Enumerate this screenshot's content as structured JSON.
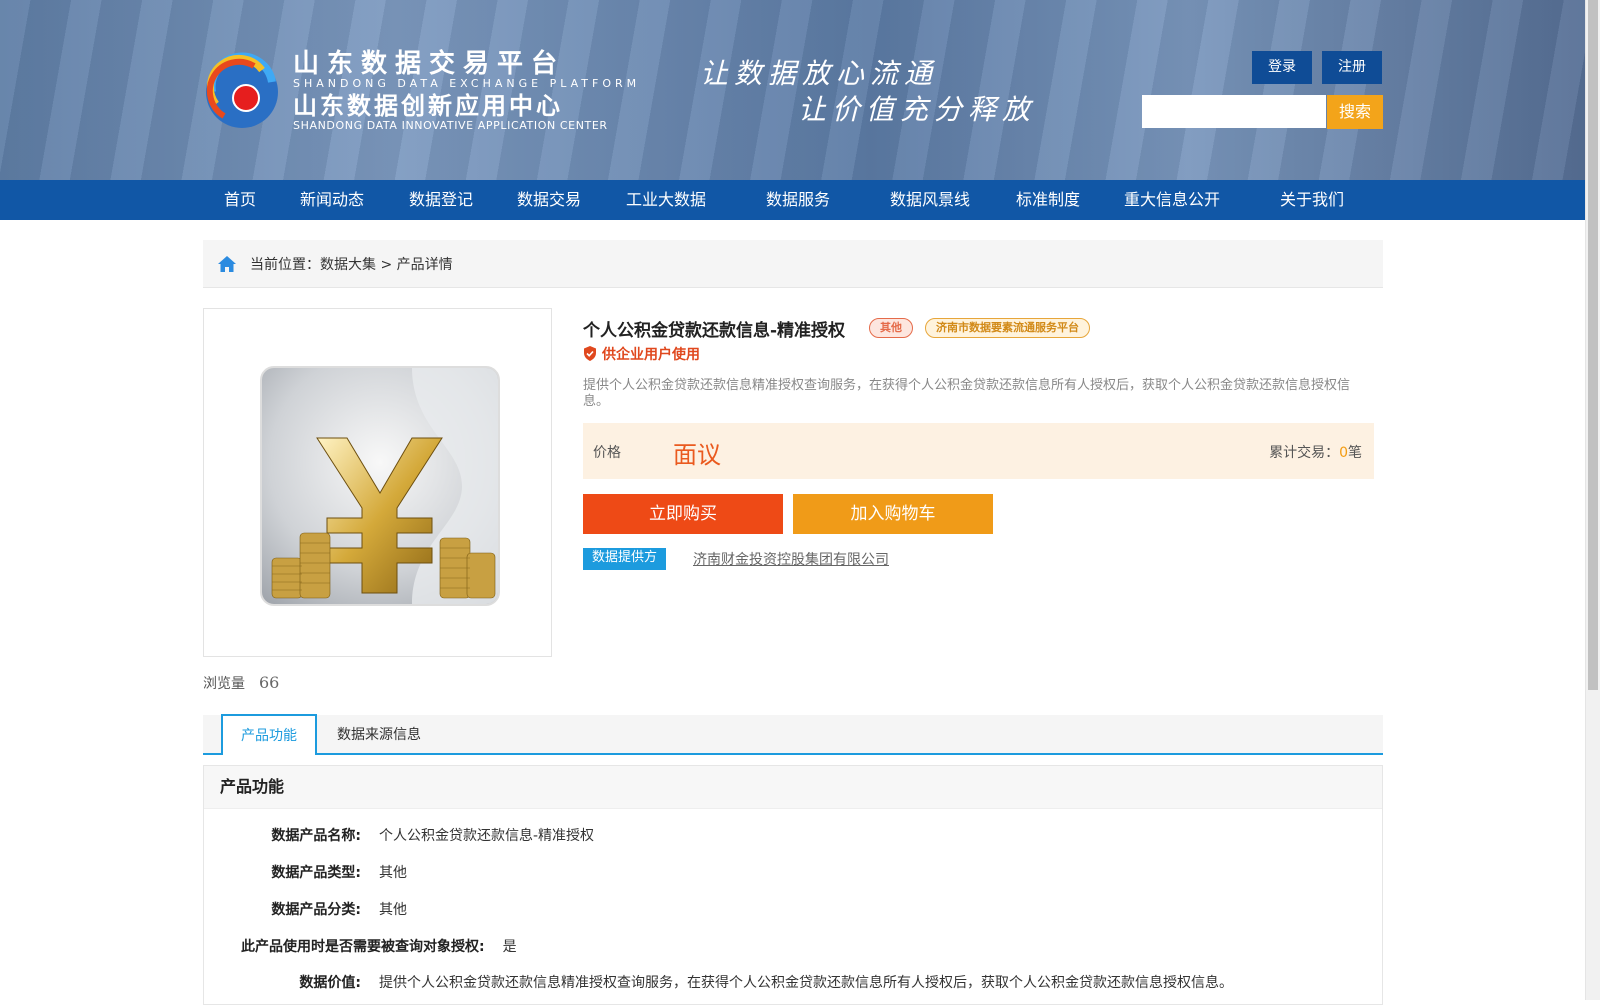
{
  "header": {
    "logo_cn1": "山东数据交易平台",
    "logo_en1": "SHANDONG DATA EXCHANGE PLATFORM",
    "logo_cn2": "山东数据创新应用中心",
    "logo_en2": "SHANDONG DATA INNOVATIVE APPLICATION CENTER",
    "slogan1": "让数据放心流通",
    "slogan2": "让价值充分释放",
    "login_label": "登录",
    "register_label": "注册",
    "search_value": "",
    "search_button": "搜索"
  },
  "nav": {
    "items": [
      "首页",
      "新闻动态",
      "数据登记",
      "数据交易",
      "工业大数据",
      "数据服务",
      "数据风景线",
      "标准制度",
      "重大信息公开",
      "关于我们"
    ]
  },
  "breadcrumb": {
    "text": "当前位置：数据大集 > 产品详情"
  },
  "product": {
    "title": "个人公积金贷款还款信息-精准授权",
    "tag_type": "其他",
    "tag_platform": "济南市数据要素流通服务平台",
    "enterprise_note": "供企业用户使用",
    "description": "提供个人公积金贷款还款信息精准授权查询服务，在获得个人公积金贷款还款信息所有人授权后，获取个人公积金贷款还款信息授权信息。",
    "price_label": "价格",
    "price_value": "面议",
    "deals_label": "累计交易：",
    "deals_count": "0",
    "deals_unit": "笔",
    "buy_label": "立即购买",
    "cart_label": "加入购物车",
    "provider_label": "数据提供方",
    "provider_name": "济南财金投资控股集团有限公司",
    "views_label": "浏览量",
    "views_count": "66",
    "image_icon": "yen-coins-hourglass-image"
  },
  "tabs": {
    "active": "产品功能",
    "second": "数据来源信息"
  },
  "section": {
    "title": "产品功能",
    "rows": [
      {
        "key": "数据产品名称:",
        "value": "个人公积金贷款还款信息-精准授权"
      },
      {
        "key": "数据产品类型:",
        "value": "其他"
      },
      {
        "key": "数据产品分类:",
        "value": "其他"
      },
      {
        "key": "此产品使用时是否需要被查询对象授权:",
        "value": "是"
      },
      {
        "key": "数据价值:",
        "value": "提供个人公积金贷款还款信息精准授权查询服务，在获得个人公积金贷款还款信息所有人授权后，获取个人公积金贷款还款信息授权信息。"
      }
    ]
  },
  "colors": {
    "nav_blue": "#1157a6",
    "accent_orange": "#f3a41a",
    "buy_red": "#ee4a16",
    "tab_blue": "#1c9bde"
  }
}
